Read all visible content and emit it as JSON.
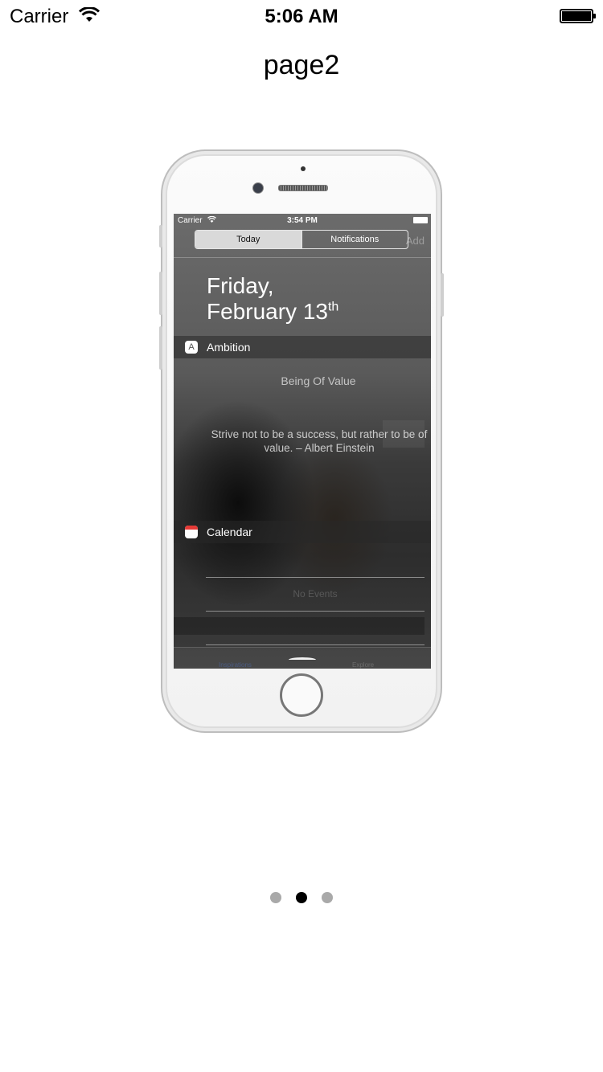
{
  "status_bar": {
    "carrier": "Carrier",
    "time": "5:06 AM"
  },
  "page": {
    "title": "page2"
  },
  "phone_screen": {
    "status": {
      "carrier": "Carrier",
      "time": "3:54 PM"
    },
    "segmented_control": {
      "items": [
        "Today",
        "Notifications"
      ],
      "selected": "Today"
    },
    "ghost_add": "Add",
    "date": {
      "line1": "Friday,",
      "line2": "February 13",
      "ordinal": "th"
    },
    "widgets": [
      {
        "name": "Ambition",
        "icon": "ambition-icon",
        "title": "Being Of Value",
        "text": "Strive not to be a success, but rather to be of value. – Albert Einstein"
      },
      {
        "name": "Calendar",
        "icon": "calendar-icon",
        "text": "No Events"
      }
    ],
    "ghost_tabs": [
      "Inspirations",
      "Explore"
    ]
  },
  "page_control": {
    "count": 3,
    "current": 2
  }
}
